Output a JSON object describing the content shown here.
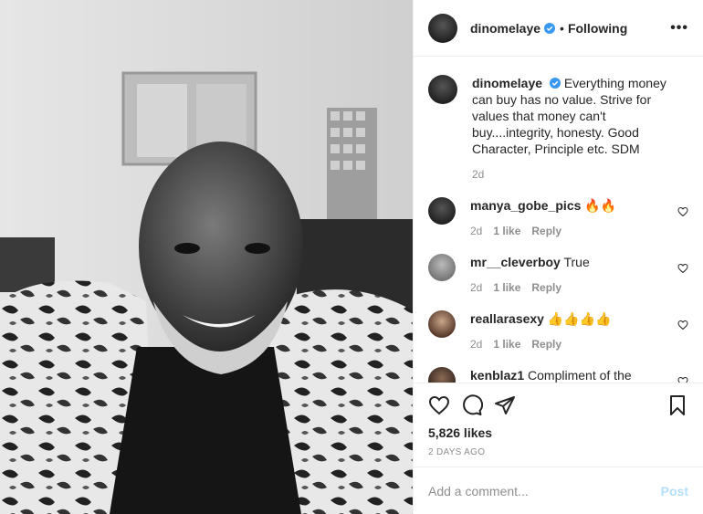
{
  "header": {
    "username": "dinomelaye",
    "separator": "•",
    "following_label": "Following",
    "more_label": "•••"
  },
  "caption": {
    "username": "dinomelaye",
    "text": "Everything money can buy has no value. Strive for values that money can't buy....integrity, honesty. Good Character, Principle etc. SDM",
    "time": "2d"
  },
  "comments": [
    {
      "username": "manya_gobe_pics",
      "text": "🔥🔥",
      "time": "2d",
      "likes": "1 like",
      "reply": "Reply"
    },
    {
      "username": "mr__cleverboy",
      "text": "True",
      "time": "2d",
      "likes": "1 like",
      "reply": "Reply"
    },
    {
      "username": "reallarasexy",
      "text": "👍👍👍👍",
      "time": "2d",
      "likes": "1 like",
      "reply": "Reply"
    },
    {
      "username": "kenblaz1",
      "text": "Compliment of the"
    }
  ],
  "actions": {
    "likes": "5,826 likes",
    "date": "2 DAYS AGO"
  },
  "add_comment": {
    "placeholder": "Add a comment...",
    "post_label": "Post"
  },
  "colors": {
    "verified": "#3897f0",
    "post_disabled": "#b2dffc",
    "secondary_text": "#8e8e8e"
  }
}
